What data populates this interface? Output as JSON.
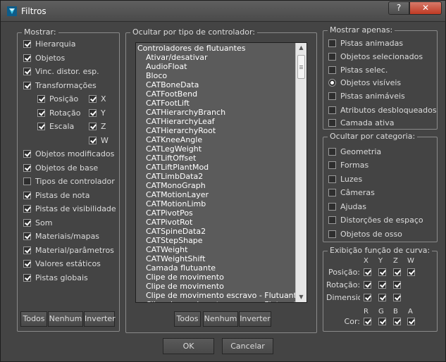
{
  "window": {
    "title": "Filtros",
    "help_label": "?",
    "close_label": "✕"
  },
  "mostrar": {
    "title": "Mostrar:",
    "items": [
      {
        "label": "Hierarquia",
        "checked": true
      },
      {
        "label": "Objetos",
        "checked": true
      },
      {
        "label": "Vinc. distor. esp.",
        "checked": true
      },
      {
        "label": "Transformações",
        "checked": true
      },
      {
        "label": "Objetos modificados",
        "checked": true
      },
      {
        "label": "Objetos de base",
        "checked": true
      },
      {
        "label": "Tipos de controlador",
        "checked": false
      },
      {
        "label": "Pistas de nota",
        "checked": true
      },
      {
        "label": "Pistas de visibilidade",
        "checked": true
      },
      {
        "label": "Som",
        "checked": true
      },
      {
        "label": "Materiais/mapas",
        "checked": true
      },
      {
        "label": "Material/parâmetros",
        "checked": true
      },
      {
        "label": "Valores estáticos",
        "checked": true
      },
      {
        "label": "Pistas globais",
        "checked": true
      }
    ],
    "sub": {
      "posicao": "Posição",
      "rotacao": "Rotação",
      "escala": "Escala",
      "x": "X",
      "y": "Y",
      "z": "Z",
      "w": "W"
    },
    "btn_todos": "Todos",
    "btn_nenhum": "Nenhum",
    "btn_inverter": "Inverter"
  },
  "ocultar_tipo": {
    "title": "Ocultar por tipo de controlador:",
    "items": [
      "Controladores de flutuantes",
      "Ativar/desativar",
      "AudioFloat",
      "Bloco",
      "CATBoneData",
      "CATFootBend",
      "CATFootLift",
      "CATHierarchyBranch",
      "CATHierarchyLeaf",
      "CATHierarchyRoot",
      "CATKneeAngle",
      "CATLegWeight",
      "CATLiftOffset",
      "CATLiftPlantMod",
      "CATLimbData2",
      "CATMonoGraph",
      "CATMotionLayer",
      "CATMotionLimb",
      "CATPivotPos",
      "CATPivotRot",
      "CATSpineData2",
      "CATStepShape",
      "CATWeight",
      "CATWeightShift",
      "Camada flutuante",
      "Clipe de movimento",
      "Clipe de movimento",
      "Clipe de movimento escravo - Flutuante",
      "Clipe de movimento escravo - Flutuante"
    ],
    "btn_todos": "Todos",
    "btn_nenhum": "Nenhum",
    "btn_inverter": "Inverter"
  },
  "mostrar_apenas": {
    "title": "Mostrar apenas:",
    "items": [
      {
        "label": "Pistas animadas",
        "checked": false,
        "type": "checkbox"
      },
      {
        "label": "Objetos selecionados",
        "checked": false,
        "type": "checkbox"
      },
      {
        "label": "Pistas selec.",
        "checked": false,
        "type": "checkbox"
      },
      {
        "label": "Objetos visíveis",
        "checked": true,
        "type": "radio"
      },
      {
        "label": "Pistas animáveis",
        "checked": false,
        "type": "checkbox"
      },
      {
        "label": "Atributos desbloqueados",
        "checked": false,
        "type": "checkbox"
      },
      {
        "label": "Camada ativa",
        "checked": false,
        "type": "checkbox"
      }
    ]
  },
  "ocultar_categoria": {
    "title": "Ocultar por categoria:",
    "items": [
      {
        "label": "Geometria",
        "checked": false
      },
      {
        "label": "Formas",
        "checked": false
      },
      {
        "label": "Luzes",
        "checked": false
      },
      {
        "label": "Câmeras",
        "checked": false
      },
      {
        "label": "Ajudas",
        "checked": false
      },
      {
        "label": "Distorções de espaço",
        "checked": false
      },
      {
        "label": "Objetos de osso",
        "checked": false
      }
    ]
  },
  "curva": {
    "title": "Exibição função de curva:",
    "axis_headers": [
      "X",
      "Y",
      "Z",
      "W"
    ],
    "posicao": "Posição:",
    "rotacao": "Rotação:",
    "dimensionar": "Dimensionar:",
    "color_headers": [
      "R",
      "G",
      "B",
      "A"
    ],
    "cor": "Cor:"
  },
  "footer": {
    "ok": "OK",
    "cancel": "Cancelar"
  }
}
